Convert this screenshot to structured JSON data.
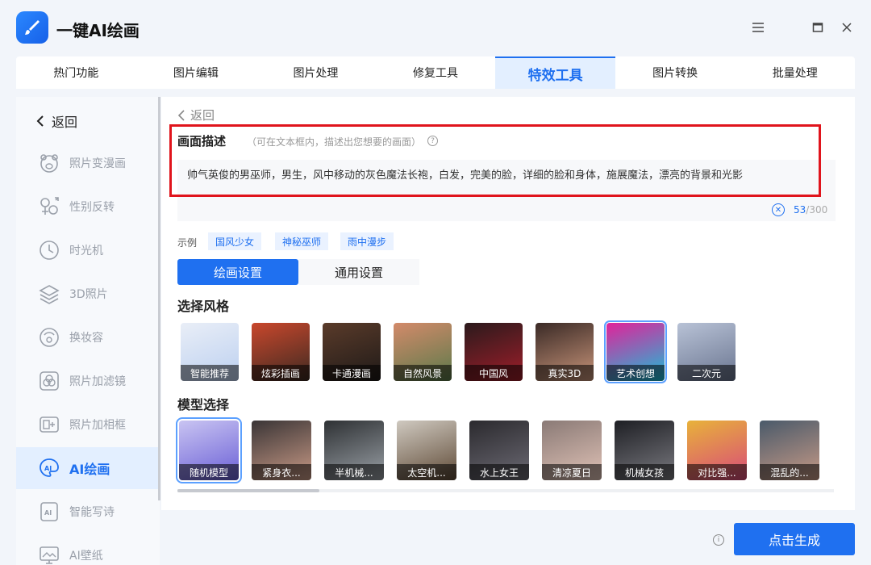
{
  "app": {
    "title": "一键AI绘画",
    "icon": "paint-brush-icon"
  },
  "window": {
    "menu_icon": "hamburger-icon",
    "maximize_icon": "maximize-icon",
    "close_icon": "close-icon"
  },
  "tabs": [
    {
      "label": "热门功能",
      "active": false
    },
    {
      "label": "图片编辑",
      "active": false
    },
    {
      "label": "图片处理",
      "active": false
    },
    {
      "label": "修复工具",
      "active": false
    },
    {
      "label": "特效工具",
      "active": true
    },
    {
      "label": "图片转换",
      "active": false
    },
    {
      "label": "批量处理",
      "active": false
    }
  ],
  "sidebar": {
    "back_label": "返回",
    "items": [
      {
        "label": "照片变漫画",
        "icon": "bear-face-icon"
      },
      {
        "label": "性别反转",
        "icon": "gender-icon"
      },
      {
        "label": "时光机",
        "icon": "clock-icon"
      },
      {
        "label": "3D照片",
        "icon": "layers-icon"
      },
      {
        "label": "换妆容",
        "icon": "makeup-face-icon"
      },
      {
        "label": "照片加滤镜",
        "icon": "filter-icon"
      },
      {
        "label": "照片加相框",
        "icon": "frame-icon"
      },
      {
        "label": "AI绘画",
        "icon": "ai-paint-icon",
        "active": true
      },
      {
        "label": "智能写诗",
        "icon": "ai-poem-icon"
      },
      {
        "label": "AI壁纸",
        "icon": "ai-wallpaper-icon"
      }
    ]
  },
  "main": {
    "back_label": "返回",
    "description": {
      "title": "画面描述",
      "hint": "（可在文本框内，描述出您想要的画面）",
      "text": "帅气英俊的男巫师，男生，风中移动的灰色魔法长袍，白发，完美的脸，详细的脸和身体，施展魔法，漂亮的背景和光影",
      "count": "53",
      "max": "/300"
    },
    "examples_label": "示例",
    "examples": [
      "国风少女",
      "神秘巫师",
      "雨中漫步"
    ],
    "settings_tabs": {
      "paint": "绘画设置",
      "general": "通用设置"
    },
    "style_title": "选择风格",
    "styles": [
      {
        "label": "智能推荐",
        "colors": [
          "#e9eef7",
          "#bcd0f0"
        ]
      },
      {
        "label": "炫彩插画",
        "colors": [
          "#c9472c",
          "#3d2a22"
        ]
      },
      {
        "label": "卡通漫画",
        "colors": [
          "#5a3b2a",
          "#1f1a18"
        ]
      },
      {
        "label": "自然风景",
        "colors": [
          "#d38a6a",
          "#5a7a4a"
        ]
      },
      {
        "label": "中国风",
        "colors": [
          "#2b1a1c",
          "#a01e2a"
        ]
      },
      {
        "label": "真实3D",
        "colors": [
          "#3a2a26",
          "#c9957a"
        ]
      },
      {
        "label": "艺术创想",
        "colors": [
          "#e2229a",
          "#18c0d8"
        ],
        "selected": true
      },
      {
        "label": "二次元",
        "colors": [
          "#b8c2d6",
          "#6a7590"
        ]
      }
    ],
    "model_title": "模型选择",
    "models": [
      {
        "label": "随机模型",
        "colors": [
          "#c9c4f2",
          "#6a5fd6"
        ],
        "selected": true
      },
      {
        "label": "紧身衣...",
        "colors": [
          "#3a3536",
          "#c99a86"
        ]
      },
      {
        "label": "半机械...",
        "colors": [
          "#2e3134",
          "#9aa0a6"
        ]
      },
      {
        "label": "太空机...",
        "colors": [
          "#cfc9c0",
          "#5f4a36"
        ]
      },
      {
        "label": "水上女王",
        "colors": [
          "#2b2a2e",
          "#6c6a74"
        ]
      },
      {
        "label": "清凉夏日",
        "colors": [
          "#8a7a76",
          "#e0c2b6"
        ]
      },
      {
        "label": "机械女孩",
        "colors": [
          "#1e1f24",
          "#7a7a80"
        ]
      },
      {
        "label": "对比强...",
        "colors": [
          "#e8b23a",
          "#d84a7a"
        ]
      },
      {
        "label": "混乱的...",
        "colors": [
          "#4a5a6a",
          "#c79a86"
        ]
      }
    ]
  },
  "footer": {
    "generate_label": "点击生成",
    "info_icon": "info-icon"
  }
}
